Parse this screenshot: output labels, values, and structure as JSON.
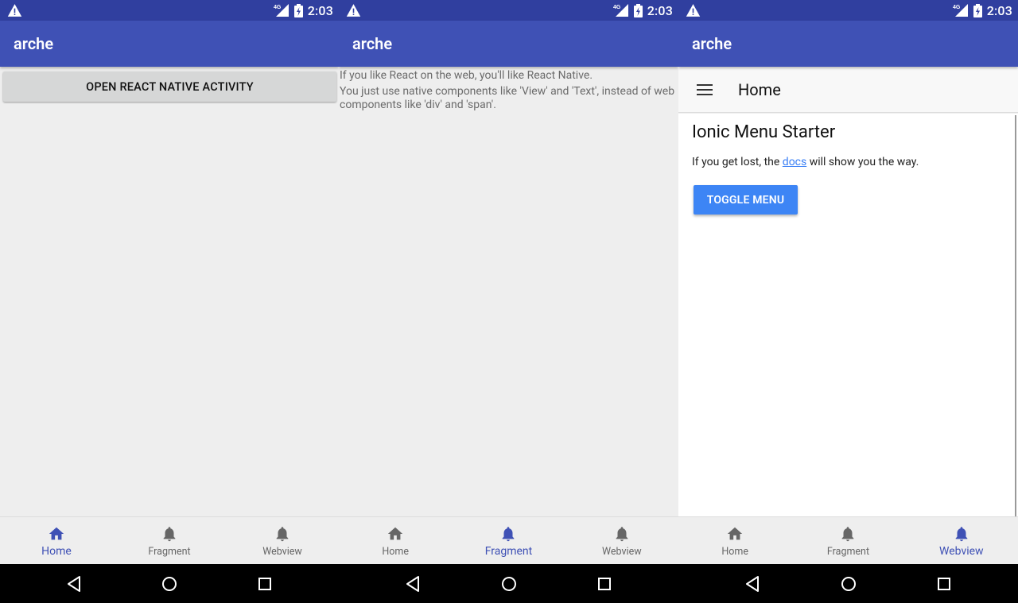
{
  "panels": [
    {
      "app_title": "arche",
      "status_time": "2:03",
      "status_network": "4G",
      "button_label": "OPEN REACT NATIVE ACTIVITY",
      "nav": [
        {
          "label": "Home",
          "icon": "home-icon",
          "active": true
        },
        {
          "label": "Fragment",
          "icon": "bell-icon",
          "active": false
        },
        {
          "label": "Webview",
          "icon": "bell-icon",
          "active": false
        }
      ]
    },
    {
      "app_title": "arche",
      "status_time": "2:03",
      "status_network": "4G",
      "text_1": "If you like React on the web, you'll like React Native.",
      "text_2": "You just use native components like 'View' and 'Text', instead of web components like 'div' and 'span'.",
      "nav": [
        {
          "label": "Home",
          "icon": "home-icon",
          "active": false
        },
        {
          "label": "Fragment",
          "icon": "bell-icon",
          "active": true
        },
        {
          "label": "Webview",
          "icon": "bell-icon",
          "active": false
        }
      ]
    },
    {
      "app_title": "arche",
      "status_time": "2:03",
      "status_network": "4G",
      "web_header_title": "Home",
      "web_title": "Ionic Menu Starter",
      "web_para_before": "If you get lost, the ",
      "web_para_link": "docs",
      "web_para_after": " will show you the way.",
      "toggle_label": "TOGGLE MENU",
      "nav": [
        {
          "label": "Home",
          "icon": "home-icon",
          "active": false
        },
        {
          "label": "Fragment",
          "icon": "bell-icon",
          "active": false
        },
        {
          "label": "Webview",
          "icon": "bell-icon",
          "active": true
        }
      ]
    }
  ],
  "colors": {
    "status_bar": "#303f9f",
    "app_bar": "#3f51b5",
    "nav_active": "#3f51b5",
    "nav_inactive": "#666666",
    "ionic_button": "#3d85f5",
    "link": "#387ef5"
  }
}
